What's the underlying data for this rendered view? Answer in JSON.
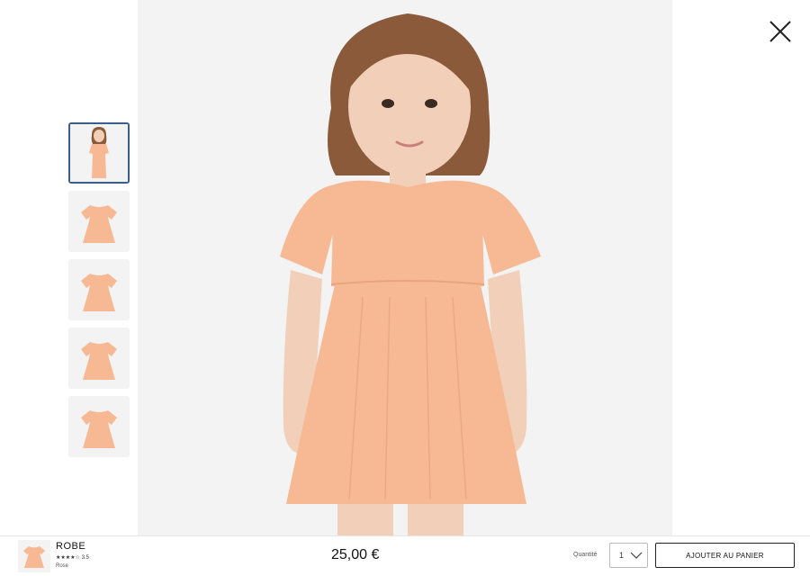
{
  "product": {
    "name": "ROBE",
    "rating": "3.5",
    "stars": "★★★★☆",
    "color_name": "Rose",
    "price": "25,00 €"
  },
  "quantity": {
    "label": "Quantité",
    "value": "1"
  },
  "actions": {
    "add_to_cart": "AJOUTER AU PANIER"
  },
  "thumbnails": [
    {
      "name": "thumbnail-model",
      "selected": true
    },
    {
      "name": "thumbnail-dress-1",
      "selected": false
    },
    {
      "name": "thumbnail-dress-2",
      "selected": false
    },
    {
      "name": "thumbnail-dress-3",
      "selected": false
    },
    {
      "name": "thumbnail-dress-4",
      "selected": false
    }
  ],
  "colors": {
    "dress": "#f6b994",
    "dress_shadow": "#e9a47e",
    "skin": "#f2cfb8",
    "hair": "#8a5a3a",
    "background": "#f3f3f3",
    "selected_border": "#3b5f8a"
  },
  "icons": {
    "close": "close-icon",
    "chevron": "chevron-down-icon"
  }
}
